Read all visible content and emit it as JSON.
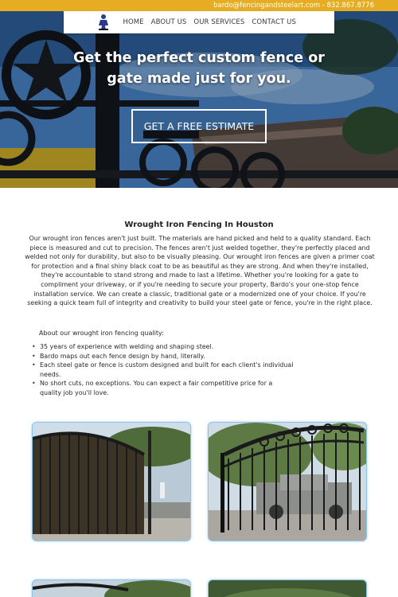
{
  "topbar": {
    "contact": "bardo@fencingandsteelart.com - 832.867.8776"
  },
  "nav": {
    "items": [
      "HOME",
      "ABOUT US",
      "OUR SERVICES",
      "CONTACT US"
    ]
  },
  "hero": {
    "title_line1": "Get the perfect custom fence or",
    "title_line2": "gate made just for you.",
    "cta": "GET A FREE ESTIMATE"
  },
  "content": {
    "title": "Wrought Iron Fencing In Houston",
    "intro": "Our wrought iron fences aren't just built. The materials are hand picked and held to a quality standard. Each piece is measured and cut to precision. The fences aren't just welded together, they're perfectly placed and welded not only for durability, but also to be visually pleasing. Our wrought iron fences are given a primer coat for protection and a final shiny black coat to be as beautiful as they are strong. And when they're installed, they're accountable to stand strong and made to last a lifetime. Whether you're looking for a gate to compliment your driveway, or if you're needing to secure your property, Bardo's your one-stop fence installation service. We can create a classic, traditional gate or a modernized one of your choice. If you're seeking a quick team full of integrity and creativity to build your steel gate or fence, you're in the right place.",
    "about_label": "About our wrought iron fencing quality:",
    "features": [
      "35 years of experience with welding and shaping steel.",
      "Bardo maps out each fence design by hand, literally.",
      "Each steel gate or fence is custom designed and built for each client's individual needs.",
      "No short cuts, no exceptions. You can expect a fair competitive price for a quality job you'll love."
    ]
  },
  "colors": {
    "topbar": "#e7ad22",
    "gallery_border": "#8cc4e8"
  }
}
